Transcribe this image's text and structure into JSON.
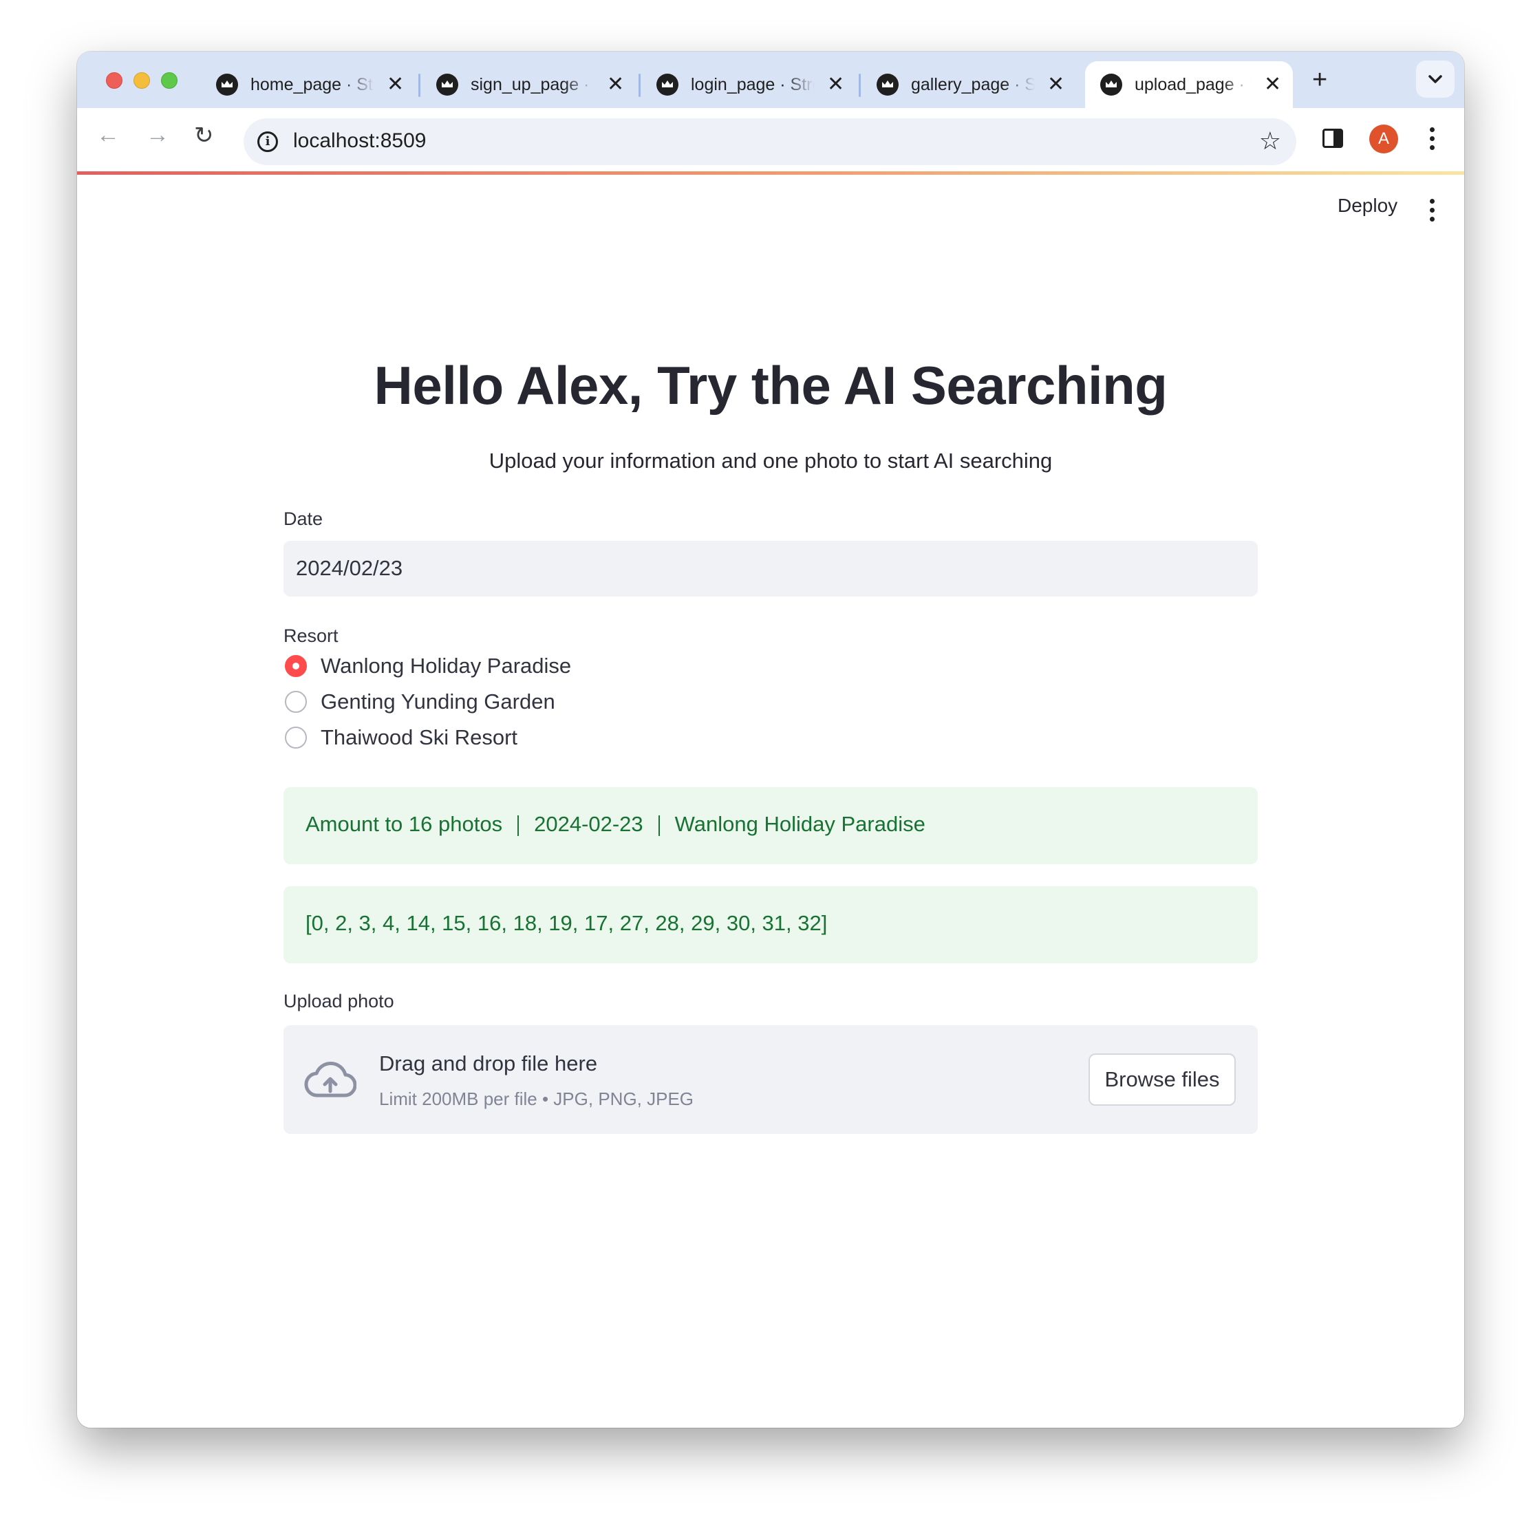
{
  "browser": {
    "tabs": [
      {
        "title": "home_page · Streamlit",
        "active": false
      },
      {
        "title": "sign_up_page · Streamlit",
        "active": false
      },
      {
        "title": "login_page · Streamlit",
        "active": false
      },
      {
        "title": "gallery_page · Streamlit",
        "active": false
      },
      {
        "title": "upload_page · Streamlit",
        "active": true
      }
    ],
    "url": "localhost:8509",
    "profile_initial": "A",
    "icons": {
      "new_tab": "+",
      "back": "←",
      "forward": "→",
      "reload": "↻",
      "info": "i",
      "star": "☆",
      "close": "✕"
    }
  },
  "app": {
    "deploy_label": "Deploy",
    "title": "Hello Alex, Try the AI Searching",
    "subtitle": "Upload your information and one photo to start AI searching",
    "date": {
      "label": "Date",
      "value": "2024/02/23"
    },
    "resort": {
      "label": "Resort",
      "options": [
        "Wanlong Holiday Paradise",
        "Genting Yunding Garden",
        "Thaiwood Ski Resort"
      ],
      "selected": "Wanlong Holiday Paradise"
    },
    "summary": {
      "amount": "Amount to 16 photos",
      "date": "2024-02-23",
      "resort": "Wanlong Holiday Paradise"
    },
    "photo_ids": "[0, 2, 3, 4, 14, 15, 16, 18, 19, 17, 27, 28, 29, 30, 31, 32]",
    "upload": {
      "label": "Upload photo",
      "drag_text": "Drag and drop file here",
      "limit_text": "Limit 200MB per file • JPG, PNG, JPEG",
      "browse_label": "Browse files"
    },
    "colors": {
      "accent": "#ff4b4b",
      "success_bg": "#ecf7ed",
      "success_text": "#177233"
    }
  }
}
